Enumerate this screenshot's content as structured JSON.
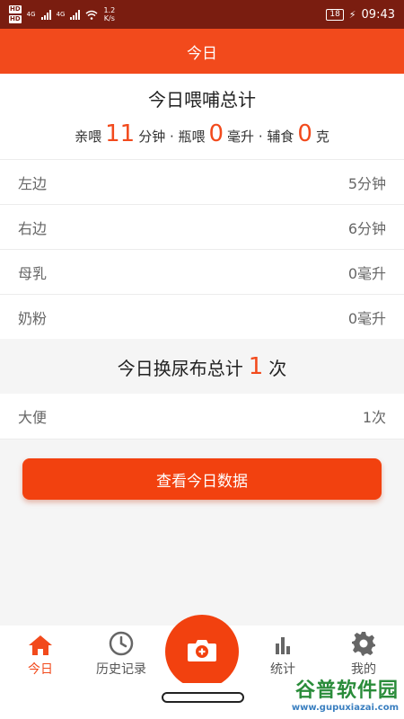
{
  "status_bar": {
    "hd1": "HD",
    "hd2": "HD",
    "net1": "4G",
    "net2": "4G",
    "speed_value": "1.2",
    "speed_unit": "K/s",
    "battery": "18",
    "time": "09:43"
  },
  "header": {
    "title": "今日"
  },
  "feeding": {
    "title": "今日喂哺总计",
    "breast_label": "亲喂",
    "breast_value": "11",
    "breast_unit": "分钟 · 瓶喂",
    "bottle_value": "0",
    "bottle_unit": "毫升 · 辅食",
    "solid_value": "0",
    "solid_unit": "克"
  },
  "rows": [
    {
      "label": "左边",
      "value": "5分钟"
    },
    {
      "label": "右边",
      "value": "6分钟"
    },
    {
      "label": "母乳",
      "value": "0毫升"
    },
    {
      "label": "奶粉",
      "value": "0毫升"
    }
  ],
  "diaper": {
    "title_prefix": "今日换尿布总计",
    "count": "1",
    "title_suffix": "次",
    "row_label": "大便",
    "row_value": "1次"
  },
  "view_button": "查看今日数据",
  "tabs": [
    {
      "label": "今日",
      "icon": "home-icon"
    },
    {
      "label": "历史记录",
      "icon": "clock-icon"
    },
    {
      "label": "",
      "icon": "camera-icon"
    },
    {
      "label": "统计",
      "icon": "bar-chart-icon"
    },
    {
      "label": "我的",
      "icon": "gear-icon"
    }
  ],
  "colors": {
    "accent": "#f24a1c",
    "status_bar": "#7a1d10"
  },
  "watermark": {
    "name": "谷普软件园",
    "url": "www.gupuxiazai.com"
  }
}
